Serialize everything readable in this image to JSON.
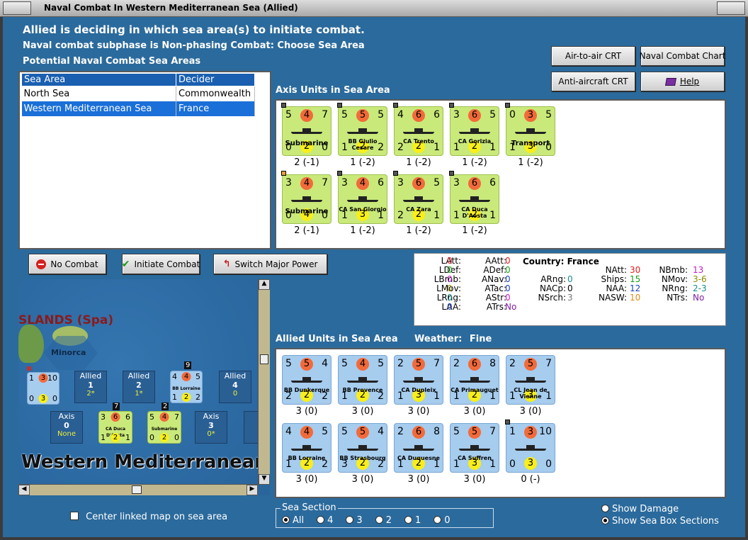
{
  "window": {
    "title": "Naval Combat In Western Mediterranean Sea (Allied)"
  },
  "headers": {
    "status": "Allied is deciding in which sea area(s) to initiate combat.",
    "subphase": "Naval combat subphase is Non-phasing Combat: Choose Sea Area",
    "potential": "Potential Naval Combat Sea Areas"
  },
  "buttons": {
    "air_to_air": "Air-to-air CRT",
    "naval_chart": "Naval Combat Chart",
    "anti_aircraft": "Anti-aircraft CRT",
    "help": "Help",
    "no_combat": "No Combat",
    "initiate": "Initiate Combat",
    "switch": "Switch Major Power"
  },
  "sea_table": {
    "col_sea": "Sea Area",
    "col_decider": "Decider",
    "rows": [
      {
        "sea": "North Sea",
        "decider": "Commonwealth"
      },
      {
        "sea": "Western Mediterranean Sea",
        "decider": "France"
      }
    ]
  },
  "axis_section": {
    "title": "Axis Units in Sea Area"
  },
  "axis_units": [
    {
      "tl": "5",
      "rc": "4",
      "tr": "7",
      "bl": "0",
      "yc": "2",
      "br": "0",
      "name": "Submarine",
      "label": "2 (-1)"
    },
    {
      "tl": "5",
      "rc": "5",
      "tr": "5",
      "bl": "1",
      "yc": "2",
      "br": "2",
      "name": "BB Giulio Cesare",
      "label": "1 (-2)"
    },
    {
      "tl": "4",
      "rc": "6",
      "tr": "6",
      "bl": "2",
      "yc": "2",
      "br": "1",
      "name": "CA Trento",
      "label": "1 (-2)"
    },
    {
      "tl": "3",
      "rc": "6",
      "tr": "5",
      "bl": "1",
      "yc": "2",
      "br": "1",
      "name": "CA Gorizia",
      "label": "1 (-2)"
    },
    {
      "tl": "0",
      "rc": "3",
      "tr": "5",
      "bl": "1",
      "yc": "3",
      "br": "0",
      "name": "Transport",
      "label": "1 (-2)"
    },
    {
      "tl": "3",
      "rc": "4",
      "tr": "7",
      "bl": "0",
      "yc": "4",
      "br": "0",
      "name": "Submarine",
      "label": "2 (-1)"
    },
    {
      "tl": "3",
      "rc": "4",
      "tr": "6",
      "bl": "1",
      "yc": "3",
      "br": "1",
      "name": "CA San Giorgio",
      "label": "1 (-2)"
    },
    {
      "tl": "3",
      "rc": "6",
      "tr": "5",
      "bl": "2",
      "yc": "2",
      "br": "1",
      "name": "CA Zara",
      "label": "1 (-2)"
    },
    {
      "tl": "3",
      "rc": "6",
      "tr": "6",
      "bl": "1",
      "yc": "2",
      "br": "1",
      "name": "CA Duca D'Aosta",
      "label": "1 (-2)"
    }
  ],
  "allied_section": {
    "title": "Allied Units in Sea Area",
    "weather_label": "Weather:",
    "weather": "Fine"
  },
  "allied_units": [
    {
      "tl": "5",
      "rc": "5",
      "tr": "4",
      "bl": "2",
      "yc": "2",
      "br": "2",
      "name": "BB Dunkerque",
      "label": "3 (0)"
    },
    {
      "tl": "5",
      "rc": "4",
      "tr": "5",
      "bl": "1",
      "yc": "2",
      "br": "2",
      "name": "BB Provence",
      "label": "3 (0)"
    },
    {
      "tl": "2",
      "rc": "5",
      "tr": "7",
      "bl": "1",
      "yc": "3",
      "br": "1",
      "name": "CA Dupleix",
      "label": "3 (0)"
    },
    {
      "tl": "2",
      "rc": "6",
      "tr": "8",
      "bl": "1",
      "yc": "2",
      "br": "1",
      "name": "CA Primauguet",
      "label": "3 (0)"
    },
    {
      "tl": "2",
      "rc": "5",
      "tr": "7",
      "bl": "1",
      "yc": "3",
      "br": "1",
      "name": "CL Jean de Vienne",
      "label": "3 (0)"
    },
    {
      "tl": "4",
      "rc": "4",
      "tr": "5",
      "bl": "1",
      "yc": "2",
      "br": "2",
      "name": "BB Lorraine",
      "label": "3 (0)"
    },
    {
      "tl": "5",
      "rc": "5",
      "tr": "4",
      "bl": "3",
      "yc": "2",
      "br": "2",
      "name": "BB Strasbourg",
      "label": "3 (0)"
    },
    {
      "tl": "2",
      "rc": "6",
      "tr": "8",
      "bl": "1",
      "yc": "2",
      "br": "1",
      "name": "CA Duquesne",
      "label": "3 (0)"
    },
    {
      "tl": "5",
      "rc": "5",
      "tr": "7",
      "bl": "1",
      "yc": "3",
      "br": "1",
      "name": "CA Suffren",
      "label": "3 (0)"
    },
    {
      "tl": "1",
      "rc": "3",
      "tr": "10",
      "bl": "0",
      "yc": "3",
      "br": "0",
      "name": "",
      "label": "0 (-)"
    }
  ],
  "stats": {
    "country_label": "Country:",
    "country": "France",
    "latt": "0",
    "ldef": "0",
    "lbmb": "0",
    "lmov": "0",
    "lrng": "0",
    "laa": "0",
    "aatt": "0",
    "adef": "0",
    "anav": "0",
    "atac": "0",
    "astr": "0",
    "atrs": "No",
    "arng": "0",
    "nacp": "0",
    "nsrch": "3",
    "natt": "30",
    "ships": "15",
    "naa": "12",
    "nasw": "10",
    "nbmb": "13",
    "nmov": "3-6",
    "nrng": "2-3",
    "ntrs": "No"
  },
  "map": {
    "islands": "SLANDS (Spa)",
    "minorca": "Minorca",
    "area": "Western Mediterranean",
    "boxes": [
      {
        "side": "Allied",
        "num": "1",
        "sub": "2*"
      },
      {
        "side": "Allied",
        "num": "2",
        "sub": "1*"
      },
      {
        "side": "Allied",
        "num": "4",
        "sub": "0"
      },
      {
        "side": "Axis",
        "num": "0",
        "sub": "None"
      },
      {
        "side": "Axis",
        "num": "3",
        "sub": "0*"
      }
    ],
    "stack_counts": [
      "9",
      "7",
      "2"
    ]
  },
  "center_map": "Center linked map on sea area",
  "sea_section": {
    "title": "Sea Section",
    "options": [
      "All",
      "4",
      "3",
      "2",
      "1",
      "0"
    ]
  },
  "show_damage": "Show Damage",
  "show_sections": "Show Sea Box Sections",
  "colors": {
    "background": "#2b6a9c",
    "axis_counter": "#c9e97a",
    "allied_counter": "#a6ccee"
  }
}
